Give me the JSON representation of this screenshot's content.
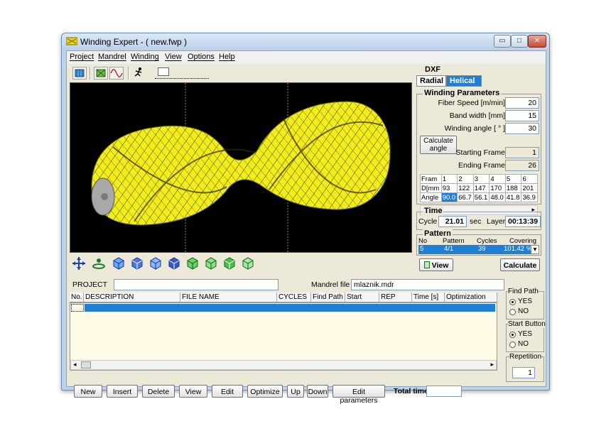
{
  "window": {
    "title": "Winding Expert  - ( new.fwp )",
    "controls": {
      "minimize": "▭",
      "maximize": "□",
      "close": "✕"
    }
  },
  "menu": [
    {
      "label": "Project"
    },
    {
      "label": "Mandrel"
    },
    {
      "label": "Winding"
    },
    {
      "label": "View"
    },
    {
      "label": "Options"
    },
    {
      "label": "Help"
    }
  ],
  "toolbar_icons": [
    "mandrel-icon",
    "path-icon",
    "sine-wave-icon",
    "runner-icon"
  ],
  "view_icons": [
    "move-axes-icon",
    "rotate-icon",
    "cube-front-icon",
    "cube-back-icon",
    "cube-left-icon",
    "cube-right-icon",
    "cube-top-icon",
    "cube-bottom-icon",
    "cube-iso-icon",
    "cube-wire-icon"
  ],
  "dxf": {
    "label": "DXF"
  },
  "tabs": {
    "radial": "Radial",
    "helical": "Helical"
  },
  "winding_parameters": {
    "title": "Winding Parameters",
    "fiber_speed_label": "Fiber Speed  [m/min]",
    "fiber_speed": "20",
    "band_width_label": "Band width [mm]",
    "band_width": "15",
    "winding_angle_label": "Winding angle [ ° ]",
    "winding_angle": "30",
    "calculate_angle": "Calculate angle",
    "starting_frame_label": "Starting Frame",
    "starting_frame": "1",
    "ending_frame_label": "Ending Frame",
    "ending_frame": "26"
  },
  "frames_table": {
    "rows": [
      [
        "Fram",
        "1",
        "2",
        "3",
        "4",
        "5",
        "6"
      ],
      [
        "D[mm",
        "93",
        "122",
        "147",
        "170",
        "188",
        "201"
      ],
      [
        "Angle",
        "90.0",
        "66.7",
        "56.1",
        "48.0",
        "41.8",
        "36.9"
      ]
    ]
  },
  "time": {
    "title": "Time",
    "cycle_label": "Cycle",
    "cycle": "21.01",
    "sec_label": "sec",
    "layer_label": "Layer",
    "layer": "00:13:39"
  },
  "pattern": {
    "title": "Pattern",
    "headers": [
      "No",
      "Pattern",
      "Cycles",
      "Covering"
    ],
    "row": [
      "5",
      "4/1",
      "39",
      "101.42 %"
    ]
  },
  "panel_buttons": {
    "view": "View",
    "calculate": "Calculate"
  },
  "project": {
    "label": "PROJECT",
    "value": "",
    "mandrel_label": "Mandrel file",
    "mandrel_value": "mlaznik.mdr"
  },
  "list_columns": [
    "No.",
    "DESCRIPTION",
    "FILE NAME",
    "CYCLES",
    "Find Path",
    "Start Button",
    "REP",
    "Time [s]",
    "Optimization"
  ],
  "find_path": {
    "title": "Find Path",
    "yes": "YES",
    "no": "NO"
  },
  "start_button": {
    "title": "Start Button",
    "yes": "YES",
    "no": "NO"
  },
  "repetition": {
    "title": "Repetition",
    "value": "1"
  },
  "actions": [
    "New",
    "Insert",
    "Delete",
    "View",
    "Edit",
    "Optimize",
    "Up",
    "Down",
    "Edit parameters"
  ],
  "total_time_label": "Total time",
  "total_time": "",
  "colors": {
    "winding": "#f2ec1a",
    "selection": "#1f7fd6",
    "list_bg": "#fffbe6"
  }
}
